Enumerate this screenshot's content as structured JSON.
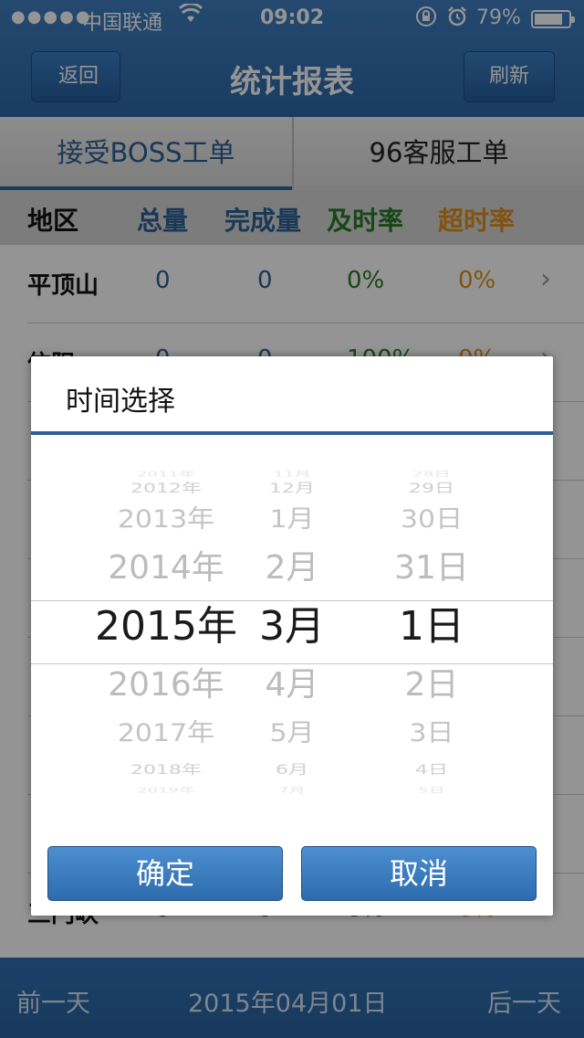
{
  "status_bar": {
    "signal": "●●●●●",
    "carrier": "中国联通",
    "time": "09:02",
    "battery": "79%"
  },
  "nav": {
    "back_label": "返回",
    "title": "统计报表",
    "refresh_label": "刷新"
  },
  "tabs": [
    {
      "label": "接受BOSS工单"
    },
    {
      "label": "96客服工单"
    }
  ],
  "table": {
    "columns": [
      "地区",
      "总量",
      "完成量",
      "及时率",
      "超时率"
    ],
    "column_colors": [
      "#111111",
      "#2c5f94",
      "#2c5f94",
      "#287a28",
      "#e0901a"
    ],
    "rows": [
      {
        "name": "平顶山",
        "total": "0",
        "done": "0",
        "timely": "0%",
        "overtime": "0%"
      },
      {
        "name": "信阳",
        "total": "0",
        "done": "0",
        "timely": "100%",
        "overtime": "0%"
      },
      {
        "name": "",
        "total": "",
        "done": "",
        "timely": "",
        "overtime": ""
      },
      {
        "name": "",
        "total": "",
        "done": "",
        "timely": "",
        "overtime": ""
      },
      {
        "name": "",
        "total": "",
        "done": "",
        "timely": "",
        "overtime": ""
      },
      {
        "name": "",
        "total": "",
        "done": "",
        "timely": "",
        "overtime": ""
      },
      {
        "name": "",
        "total": "",
        "done": "",
        "timely": "",
        "overtime": ""
      },
      {
        "name": "",
        "total": "",
        "done": "",
        "timely": "",
        "overtime": ""
      },
      {
        "name": "三门峡",
        "total": "0",
        "done": "0",
        "timely": "0%",
        "overtime": "0%"
      }
    ]
  },
  "footer": {
    "prev_label": "前一天",
    "date": "2015年04月01日",
    "next_label": "后一天"
  },
  "dialog": {
    "title": "时间选择",
    "years": [
      "2011年",
      "2012年",
      "2013年",
      "2014年",
      "2015年",
      "2016年",
      "2017年",
      "2018年",
      "2019年"
    ],
    "months": [
      "11月",
      "12月",
      "1月",
      "2月",
      "3月",
      "4月",
      "5月",
      "6月",
      "7月"
    ],
    "days": [
      "28日",
      "29日",
      "30日",
      "31日",
      "1日",
      "2日",
      "3日",
      "4日",
      "5日"
    ],
    "selected": {
      "year": "2015年",
      "month": "3月",
      "day": "1日"
    },
    "confirm_label": "确定",
    "cancel_label": "取消"
  },
  "colors": {
    "nav_blue": "#2c67a8",
    "accent_blue": "#2c5f94",
    "green": "#287a28",
    "orange": "#e0901a"
  }
}
